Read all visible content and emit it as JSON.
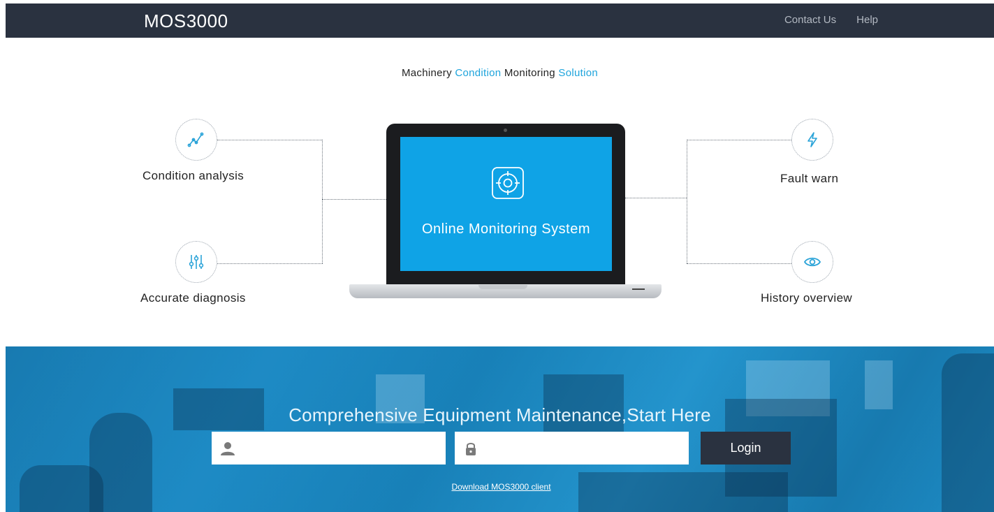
{
  "header": {
    "brand": "MOS3000",
    "nav": [
      {
        "label": "Contact Us"
      },
      {
        "label": "Help"
      }
    ]
  },
  "tagline": {
    "parts": [
      "Machinery ",
      "Condition",
      " Monitoring ",
      "Solution"
    ]
  },
  "features": [
    {
      "label": "Condition analysis",
      "icon": "trend-line-icon"
    },
    {
      "label": "Accurate diagnosis",
      "icon": "sliders-icon"
    },
    {
      "label": "Fault warn",
      "icon": "lightning-icon"
    },
    {
      "label": "History overview",
      "icon": "eye-icon"
    }
  ],
  "laptop": {
    "screen_title": "Online Monitoring System",
    "screen_icon": "target-icon"
  },
  "hero": {
    "title": "Comprehensive Equipment Maintenance,Start Here",
    "username_icon": "user-icon",
    "password_icon": "lock-icon",
    "username_value": "",
    "password_value": "",
    "login_label": "Login",
    "download_label": "Download MOS3000 client"
  },
  "colors": {
    "header_bg": "#2a3240",
    "accent": "#1ea4dc",
    "screen": "#0fa3e6",
    "icon_blue": "#2aa3d8"
  }
}
